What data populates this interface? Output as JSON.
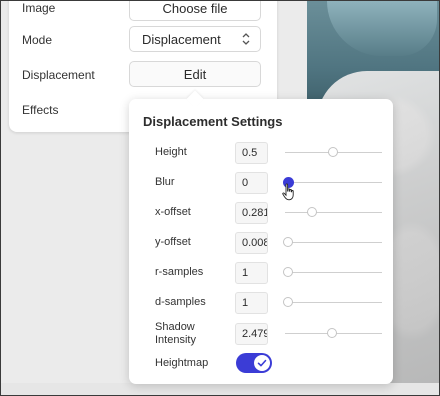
{
  "panel": {
    "rows": [
      {
        "label": "Image",
        "value": "Choose file"
      },
      {
        "label": "Mode",
        "value": "Displacement"
      },
      {
        "label": "Displacement",
        "value": "Edit"
      },
      {
        "label": "Effects"
      }
    ]
  },
  "popover": {
    "title": "Displacement Settings",
    "sliders": [
      {
        "label": "Height",
        "value": "0.5",
        "level": 0.52
      },
      {
        "label": "Blur",
        "value": "0",
        "level": 0.0
      },
      {
        "label": "x-offset",
        "value": "0.281",
        "level": 0.28
      },
      {
        "label": "y-offset",
        "value": "0.008",
        "level": 0.0
      },
      {
        "label": "r-samples",
        "value": "1",
        "level": 0.0
      },
      {
        "label": "d-samples",
        "value": "1",
        "level": 0.0
      },
      {
        "label": "Shadow Intensity",
        "value": "2.479",
        "level": 0.5
      }
    ],
    "heightmap": {
      "label": "Heightmap",
      "on": true
    }
  },
  "colors": {
    "accent": "#3b3cd6"
  }
}
